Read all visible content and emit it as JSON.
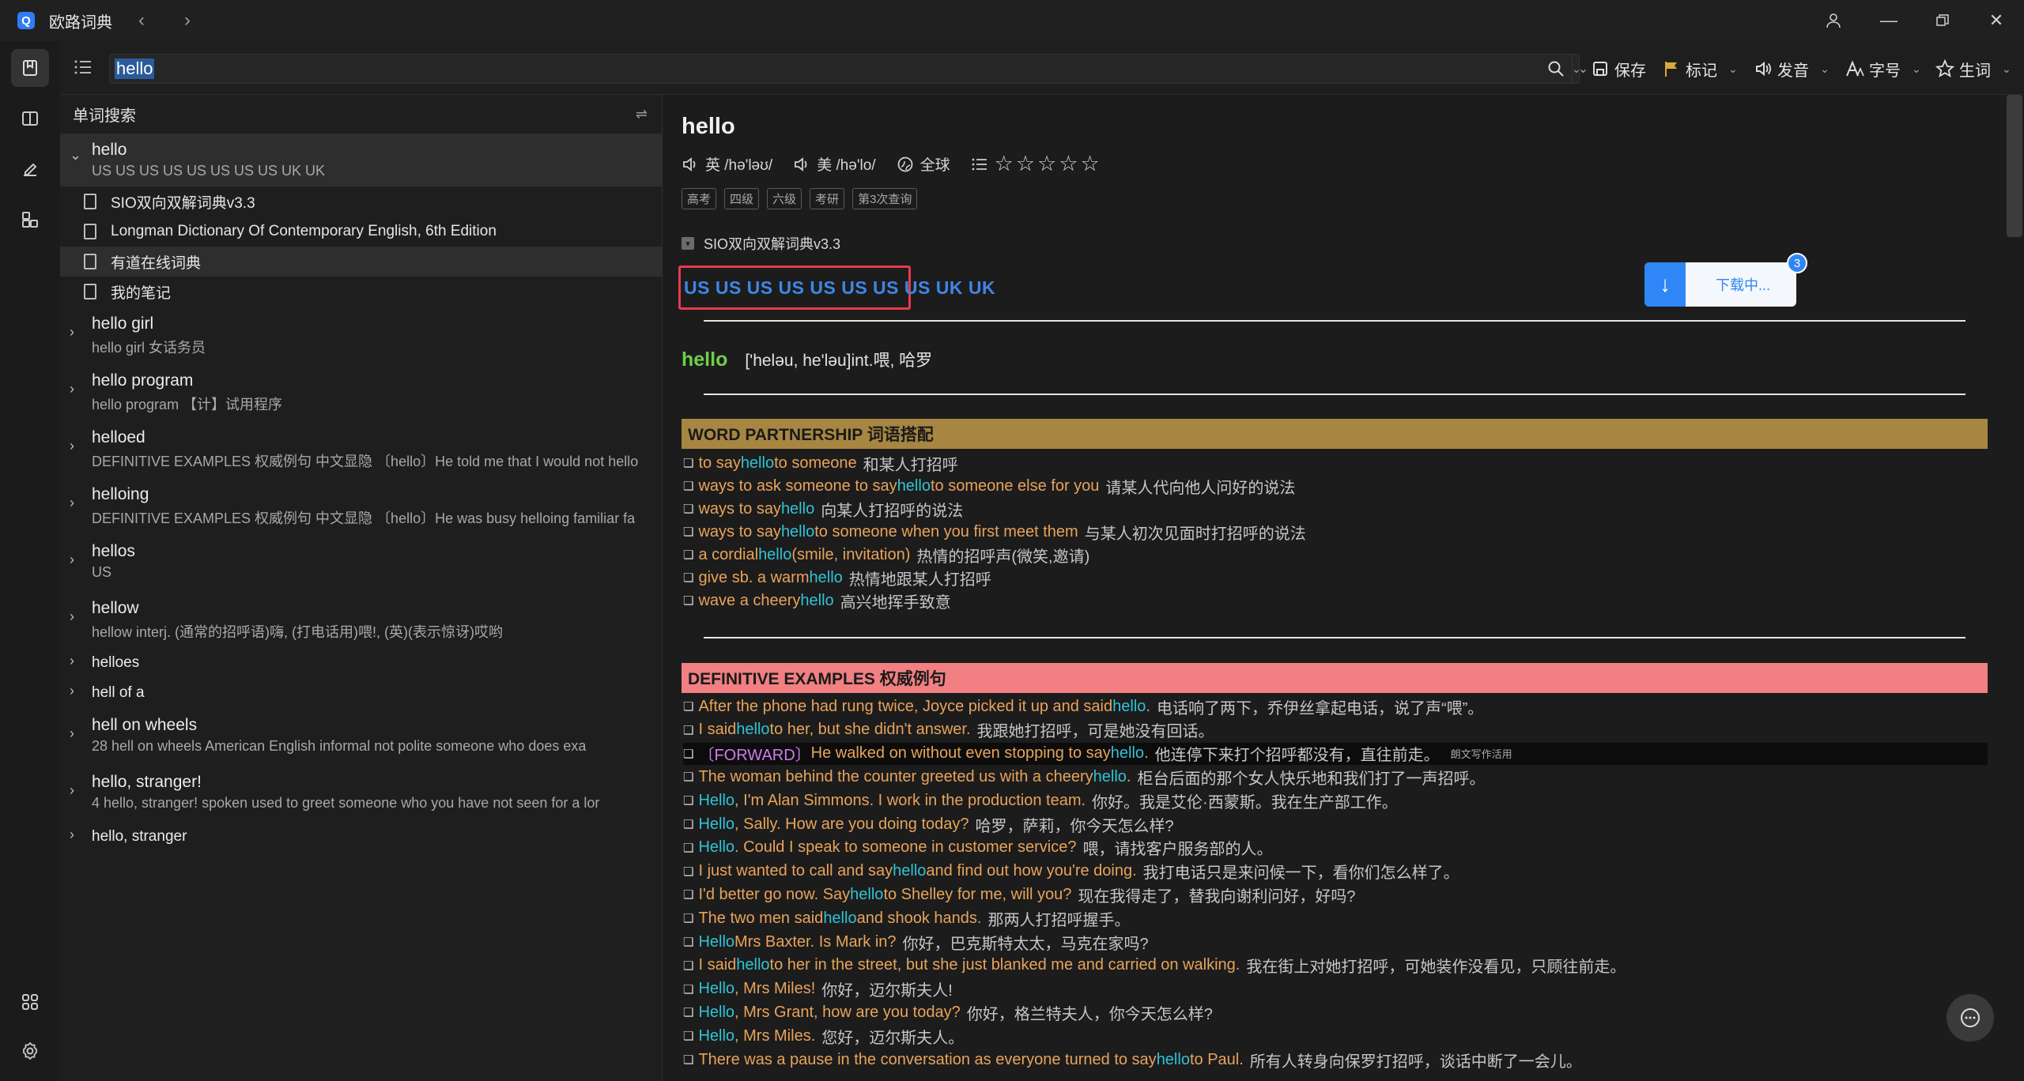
{
  "app": {
    "title": "欧路词典",
    "logo_letter": "Q"
  },
  "search": {
    "value": "hello"
  },
  "toolbar": {
    "save": "保存",
    "mark": "标记",
    "speak": "发音",
    "font": "字号",
    "vocab": "生词"
  },
  "left_panel": {
    "header": "单词搜索",
    "entries": [
      {
        "word": "hello",
        "desc": "US US US US US US US US UK UK",
        "expanded": true,
        "dicts": [
          "SIO双向双解词典v3.3",
          "Longman Dictionary Of Contemporary English, 6th Edition",
          "有道在线词典",
          "我的笔记"
        ]
      },
      {
        "word": "hello girl",
        "desc": "hello girl    女话务员"
      },
      {
        "word": "hello program",
        "desc": "hello program    【计】试用程序"
      },
      {
        "word": "helloed",
        "desc": "DEFINITIVE EXAMPLES 权威例句  中文显隐  〔hello〕He told me that I would not hello"
      },
      {
        "word": "helloing",
        "desc": "DEFINITIVE EXAMPLES 权威例句  中文显隐  〔hello〕He was busy   helloing familiar fa"
      },
      {
        "word": "hellos",
        "desc": "US"
      },
      {
        "word": "hellow",
        "desc": "hellow    interj. (通常的招呼语)嗨, (打电话用)喂!, (英)(表示惊讶)哎哟"
      },
      {
        "word": "helloes",
        "desc": ""
      },
      {
        "word": "hell of a",
        "desc": ""
      },
      {
        "word": "hell on wheels",
        "desc": "28  hell on wheels   American English   informal   not polite   someone who does exa"
      },
      {
        "word": "hello, stranger!",
        "desc": "4  hello, stranger!   spoken   used to greet someone who you have not seen for a lor"
      },
      {
        "word": "hello, stranger",
        "desc": ""
      }
    ]
  },
  "content": {
    "headword": "hello",
    "uk_label": "英 /hə'ləʊ/",
    "us_label": "美 /hə'lo/",
    "global_label": "全球",
    "stars": 5,
    "tags": [
      "高考",
      "四级",
      "六级",
      "考研",
      "第3次查询"
    ],
    "dict_name": "SIO双向双解词典v3.3",
    "us_box": "US US US US US US US US UK UK",
    "download": {
      "label": "下载中...",
      "badge": "3"
    },
    "def_headword": "hello",
    "def_text": "['heləu, he'ləu]int.喂, 哈罗",
    "wp_title": "WORD PARTNERSHIP 词语搭配",
    "wp_lines": [
      {
        "pre": "to say ",
        "kw": "hello",
        "post": " to someone",
        "zh": "和某人打招呼"
      },
      {
        "pre": "ways to ask someone to say ",
        "kw": "hello",
        "post": " to someone else for you",
        "zh": "请某人代向他人问好的说法"
      },
      {
        "pre": "ways to say ",
        "kw": "hello",
        "post": "",
        "zh": "向某人打招呼的说法"
      },
      {
        "pre": "ways to say ",
        "kw": "hello",
        "post": " to someone when you first meet them",
        "zh": "与某人初次见面时打招呼的说法"
      },
      {
        "pre": "a cordial ",
        "kw": "hello",
        "post": " (smile, invitation)",
        "zh": "热情的招呼声(微笑,邀请)"
      },
      {
        "pre": "give sb. a warm ",
        "kw": "hello",
        "post": "",
        "zh": "热情地跟某人打招呼"
      },
      {
        "pre": "wave a cheery ",
        "kw": "hello",
        "post": "",
        "zh": "高兴地挥手致意"
      }
    ],
    "de_title": "DEFINITIVE EXAMPLES 权威例句",
    "de_lines": [
      {
        "pre": "After the phone had rung twice, Joyce picked it up and said ",
        "kw": "hello",
        "post": ".",
        "zh": "电话响了两下，乔伊丝拿起电话，说了声“喂”。"
      },
      {
        "pre": "I said ",
        "kw": "hello",
        "post": " to her, but she didn't answer.",
        "zh": "我跟她打招呼，可是她没有回话。"
      },
      {
        "fw": "〔FORWARD〕",
        "pre": "He walked on without even stopping to say ",
        "kw": "hello",
        "post": ".",
        "zh": "他连停下来打个招呼都没有，直往前走。",
        "note": "朗文写作活用"
      },
      {
        "pre": "The woman behind the counter greeted us with a cheery ",
        "kw": "hello",
        "post": ".",
        "zh": "柜台后面的那个女人快乐地和我们打了一声招呼。"
      },
      {
        "pre": "",
        "kw": "Hello",
        "post": ", I'm Alan Simmons. I work in the production team.",
        "zh": "你好。我是艾伦·西蒙斯。我在生产部工作。"
      },
      {
        "pre": "",
        "kw": "Hello",
        "post": ", Sally. How are you doing today?",
        "zh": "哈罗，萨莉，你今天怎么样?"
      },
      {
        "pre": "",
        "kw": "Hello",
        "post": ". Could I speak to someone in customer service?",
        "zh": "喂，请找客户服务部的人。"
      },
      {
        "pre": "I just wanted to call and say ",
        "kw": "hello",
        "post": " and find out how you're doing.",
        "zh": "我打电话只是来问候一下，看你们怎么样了。"
      },
      {
        "pre": "I'd better go now. Say ",
        "kw": "hello",
        "post": " to Shelley for me, will you?",
        "zh": "现在我得走了，替我向谢利问好，好吗?"
      },
      {
        "pre": "The two men said ",
        "kw": "hello",
        "post": " and shook hands.",
        "zh": "那两人打招呼握手。"
      },
      {
        "pre": "",
        "kw": "Hello",
        "post": " Mrs Baxter. Is Mark in?",
        "zh": "你好，巴克斯特太太，马克在家吗?"
      },
      {
        "pre": "I said ",
        "kw": "hello",
        "post": " to her in the street, but she just blanked me and carried on walking.",
        "zh": "我在街上对她打招呼，可她装作没看见，只顾往前走。"
      },
      {
        "pre": "",
        "kw": "Hello",
        "post": ", Mrs Miles!",
        "zh": "你好，迈尔斯夫人!"
      },
      {
        "pre": "",
        "kw": "Hello",
        "post": ", Mrs Grant, how are you today?",
        "zh": "你好，格兰特夫人，你今天怎么样?"
      },
      {
        "pre": "",
        "kw": "Hello",
        "post": ", Mrs Miles.",
        "zh": "您好，迈尔斯夫人。"
      },
      {
        "pre": "There was a pause in the conversation as everyone turned to say ",
        "kw": "hello",
        "post": " to Paul.",
        "zh": "所有人转身向保罗打招呼，谈话中断了一会儿。"
      }
    ]
  }
}
